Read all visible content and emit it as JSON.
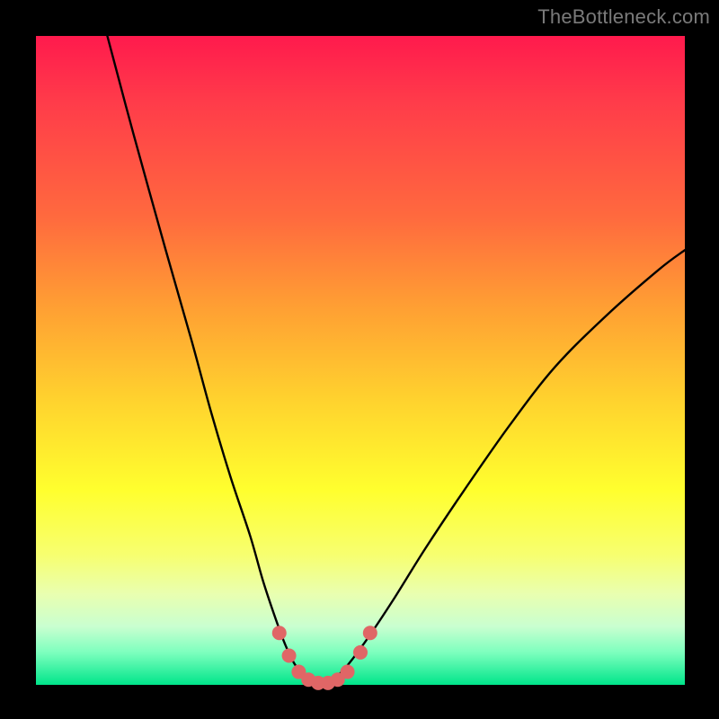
{
  "watermark": {
    "text": "TheBottleneck.com"
  },
  "colors": {
    "background": "#000000",
    "gradient_top": "#ff1a4d",
    "gradient_mid": "#ffd22e",
    "gradient_bottom": "#00e58a",
    "curve": "#000000",
    "dot": "#e06666"
  },
  "chart_data": {
    "type": "line",
    "title": "",
    "xlabel": "",
    "ylabel": "",
    "xlim": [
      0,
      100
    ],
    "ylim": [
      0,
      100
    ],
    "grid": false,
    "legend": false,
    "annotations": [],
    "series": [
      {
        "name": "bottleneck-curve",
        "x": [
          11,
          15,
          20,
          24,
          27,
          30,
          33,
          35,
          37,
          38.5,
          40,
          42,
          44,
          46,
          48,
          51,
          55,
          60,
          66,
          73,
          80,
          88,
          96,
          100
        ],
        "y": [
          100,
          85,
          67,
          53,
          42,
          32,
          23,
          16,
          10,
          6,
          3,
          1,
          0,
          1,
          3,
          7,
          13,
          21,
          30,
          40,
          49,
          57,
          64,
          67
        ]
      }
    ],
    "dots": {
      "name": "highlight-dots",
      "points": [
        {
          "x": 37.5,
          "y": 8
        },
        {
          "x": 39,
          "y": 4.5
        },
        {
          "x": 40.5,
          "y": 2
        },
        {
          "x": 42,
          "y": 0.8
        },
        {
          "x": 43.5,
          "y": 0.3
        },
        {
          "x": 45,
          "y": 0.3
        },
        {
          "x": 46.5,
          "y": 0.8
        },
        {
          "x": 48,
          "y": 2
        },
        {
          "x": 50,
          "y": 5
        },
        {
          "x": 51.5,
          "y": 8
        }
      ]
    }
  }
}
